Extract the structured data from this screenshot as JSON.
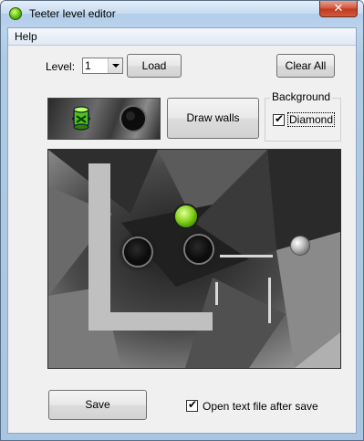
{
  "window": {
    "title": "Teeter level editor",
    "close_glyph": "✕"
  },
  "menu": {
    "help_label": "Help"
  },
  "toolbar": {
    "level_label": "Level:",
    "level_value": "1",
    "load_label": "Load",
    "clear_all_label": "Clear All",
    "draw_walls_label": "Draw walls"
  },
  "background_group": {
    "title": "Background",
    "diamond_label": "Diamond",
    "diamond_checked": true
  },
  "palette": {
    "items": [
      "goal-hole-icon",
      "hole-icon"
    ]
  },
  "board": {
    "pieces": [
      "green-goal-ball",
      "hole",
      "hole",
      "steel-ball",
      "l-wall",
      "thin-walls"
    ]
  },
  "footer": {
    "save_label": "Save",
    "open_text_label": "Open text file after save",
    "open_text_checked": true
  },
  "colors": {
    "accent_green": "#6cc214",
    "close_red": "#c84a30"
  }
}
